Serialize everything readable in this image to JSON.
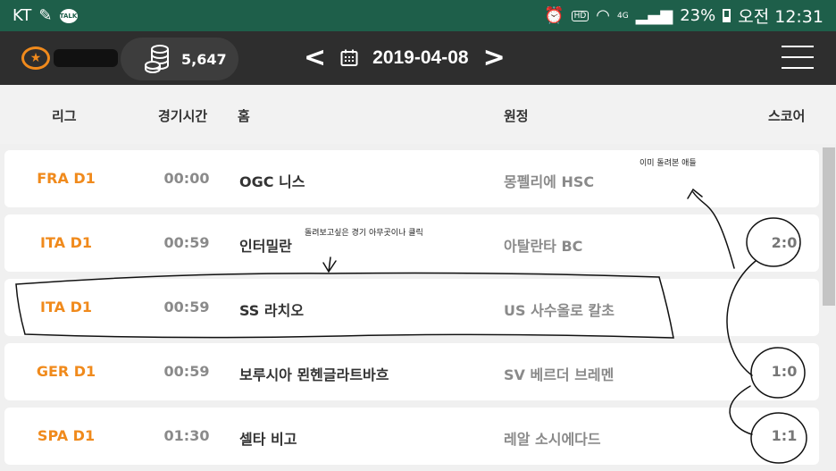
{
  "status_bar": {
    "carrier": "KT",
    "kakao_label": "TALK",
    "network": "4G",
    "battery": "23%",
    "time": "오전 12:31"
  },
  "header": {
    "coins": "5,647",
    "date": "2019-04-08"
  },
  "columns": {
    "league": "리그",
    "time": "경기시간",
    "home": "홈",
    "away": "원정",
    "score": "스코어"
  },
  "matches": [
    {
      "league": "FRA D1",
      "time": "00:00",
      "home": "OGC 니스",
      "away": "몽펠리에 HSC",
      "score": ""
    },
    {
      "league": "ITA D1",
      "time": "00:59",
      "home": "인터밀란",
      "away": "아탈란타 BC",
      "score": "2:0"
    },
    {
      "league": "ITA D1",
      "time": "00:59",
      "home": "SS 라치오",
      "away": "US 사수올로 칼초",
      "score": ""
    },
    {
      "league": "GER D1",
      "time": "00:59",
      "home": "보루시아 묀헨글라트바흐",
      "away": "SV 베르더 브레멘",
      "score": "1:0"
    },
    {
      "league": "SPA D1",
      "time": "01:30",
      "home": "셀타 비고",
      "away": "레알 소시에다드",
      "score": "1:1"
    }
  ],
  "annotations": {
    "note_click": "돌려보고싶은 경기 아무곳이나 클릭",
    "note_watched": "이미 돌려본 애들"
  },
  "colors": {
    "status_bar": "#1e5f4a",
    "header": "#2e2e2e",
    "accent": "#f08a1c"
  }
}
